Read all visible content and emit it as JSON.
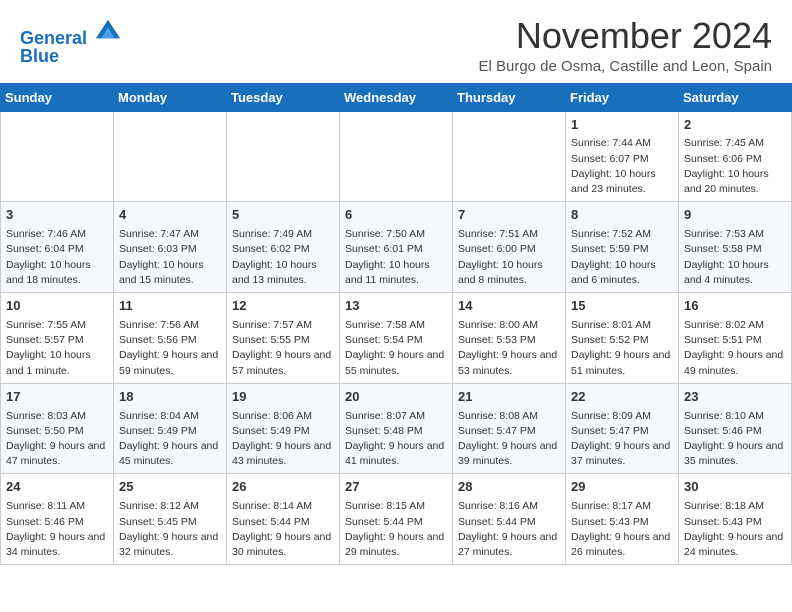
{
  "logo": {
    "line1": "General",
    "line2": "Blue"
  },
  "title": "November 2024",
  "location": "El Burgo de Osma, Castille and Leon, Spain",
  "weekdays": [
    "Sunday",
    "Monday",
    "Tuesday",
    "Wednesday",
    "Thursday",
    "Friday",
    "Saturday"
  ],
  "weeks": [
    [
      {
        "day": "",
        "info": ""
      },
      {
        "day": "",
        "info": ""
      },
      {
        "day": "",
        "info": ""
      },
      {
        "day": "",
        "info": ""
      },
      {
        "day": "",
        "info": ""
      },
      {
        "day": "1",
        "info": "Sunrise: 7:44 AM\nSunset: 6:07 PM\nDaylight: 10 hours and 23 minutes."
      },
      {
        "day": "2",
        "info": "Sunrise: 7:45 AM\nSunset: 6:06 PM\nDaylight: 10 hours and 20 minutes."
      }
    ],
    [
      {
        "day": "3",
        "info": "Sunrise: 7:46 AM\nSunset: 6:04 PM\nDaylight: 10 hours and 18 minutes."
      },
      {
        "day": "4",
        "info": "Sunrise: 7:47 AM\nSunset: 6:03 PM\nDaylight: 10 hours and 15 minutes."
      },
      {
        "day": "5",
        "info": "Sunrise: 7:49 AM\nSunset: 6:02 PM\nDaylight: 10 hours and 13 minutes."
      },
      {
        "day": "6",
        "info": "Sunrise: 7:50 AM\nSunset: 6:01 PM\nDaylight: 10 hours and 11 minutes."
      },
      {
        "day": "7",
        "info": "Sunrise: 7:51 AM\nSunset: 6:00 PM\nDaylight: 10 hours and 8 minutes."
      },
      {
        "day": "8",
        "info": "Sunrise: 7:52 AM\nSunset: 5:59 PM\nDaylight: 10 hours and 6 minutes."
      },
      {
        "day": "9",
        "info": "Sunrise: 7:53 AM\nSunset: 5:58 PM\nDaylight: 10 hours and 4 minutes."
      }
    ],
    [
      {
        "day": "10",
        "info": "Sunrise: 7:55 AM\nSunset: 5:57 PM\nDaylight: 10 hours and 1 minute."
      },
      {
        "day": "11",
        "info": "Sunrise: 7:56 AM\nSunset: 5:56 PM\nDaylight: 9 hours and 59 minutes."
      },
      {
        "day": "12",
        "info": "Sunrise: 7:57 AM\nSunset: 5:55 PM\nDaylight: 9 hours and 57 minutes."
      },
      {
        "day": "13",
        "info": "Sunrise: 7:58 AM\nSunset: 5:54 PM\nDaylight: 9 hours and 55 minutes."
      },
      {
        "day": "14",
        "info": "Sunrise: 8:00 AM\nSunset: 5:53 PM\nDaylight: 9 hours and 53 minutes."
      },
      {
        "day": "15",
        "info": "Sunrise: 8:01 AM\nSunset: 5:52 PM\nDaylight: 9 hours and 51 minutes."
      },
      {
        "day": "16",
        "info": "Sunrise: 8:02 AM\nSunset: 5:51 PM\nDaylight: 9 hours and 49 minutes."
      }
    ],
    [
      {
        "day": "17",
        "info": "Sunrise: 8:03 AM\nSunset: 5:50 PM\nDaylight: 9 hours and 47 minutes."
      },
      {
        "day": "18",
        "info": "Sunrise: 8:04 AM\nSunset: 5:49 PM\nDaylight: 9 hours and 45 minutes."
      },
      {
        "day": "19",
        "info": "Sunrise: 8:06 AM\nSunset: 5:49 PM\nDaylight: 9 hours and 43 minutes."
      },
      {
        "day": "20",
        "info": "Sunrise: 8:07 AM\nSunset: 5:48 PM\nDaylight: 9 hours and 41 minutes."
      },
      {
        "day": "21",
        "info": "Sunrise: 8:08 AM\nSunset: 5:47 PM\nDaylight: 9 hours and 39 minutes."
      },
      {
        "day": "22",
        "info": "Sunrise: 8:09 AM\nSunset: 5:47 PM\nDaylight: 9 hours and 37 minutes."
      },
      {
        "day": "23",
        "info": "Sunrise: 8:10 AM\nSunset: 5:46 PM\nDaylight: 9 hours and 35 minutes."
      }
    ],
    [
      {
        "day": "24",
        "info": "Sunrise: 8:11 AM\nSunset: 5:46 PM\nDaylight: 9 hours and 34 minutes."
      },
      {
        "day": "25",
        "info": "Sunrise: 8:12 AM\nSunset: 5:45 PM\nDaylight: 9 hours and 32 minutes."
      },
      {
        "day": "26",
        "info": "Sunrise: 8:14 AM\nSunset: 5:44 PM\nDaylight: 9 hours and 30 minutes."
      },
      {
        "day": "27",
        "info": "Sunrise: 8:15 AM\nSunset: 5:44 PM\nDaylight: 9 hours and 29 minutes."
      },
      {
        "day": "28",
        "info": "Sunrise: 8:16 AM\nSunset: 5:44 PM\nDaylight: 9 hours and 27 minutes."
      },
      {
        "day": "29",
        "info": "Sunrise: 8:17 AM\nSunset: 5:43 PM\nDaylight: 9 hours and 26 minutes."
      },
      {
        "day": "30",
        "info": "Sunrise: 8:18 AM\nSunset: 5:43 PM\nDaylight: 9 hours and 24 minutes."
      }
    ]
  ]
}
